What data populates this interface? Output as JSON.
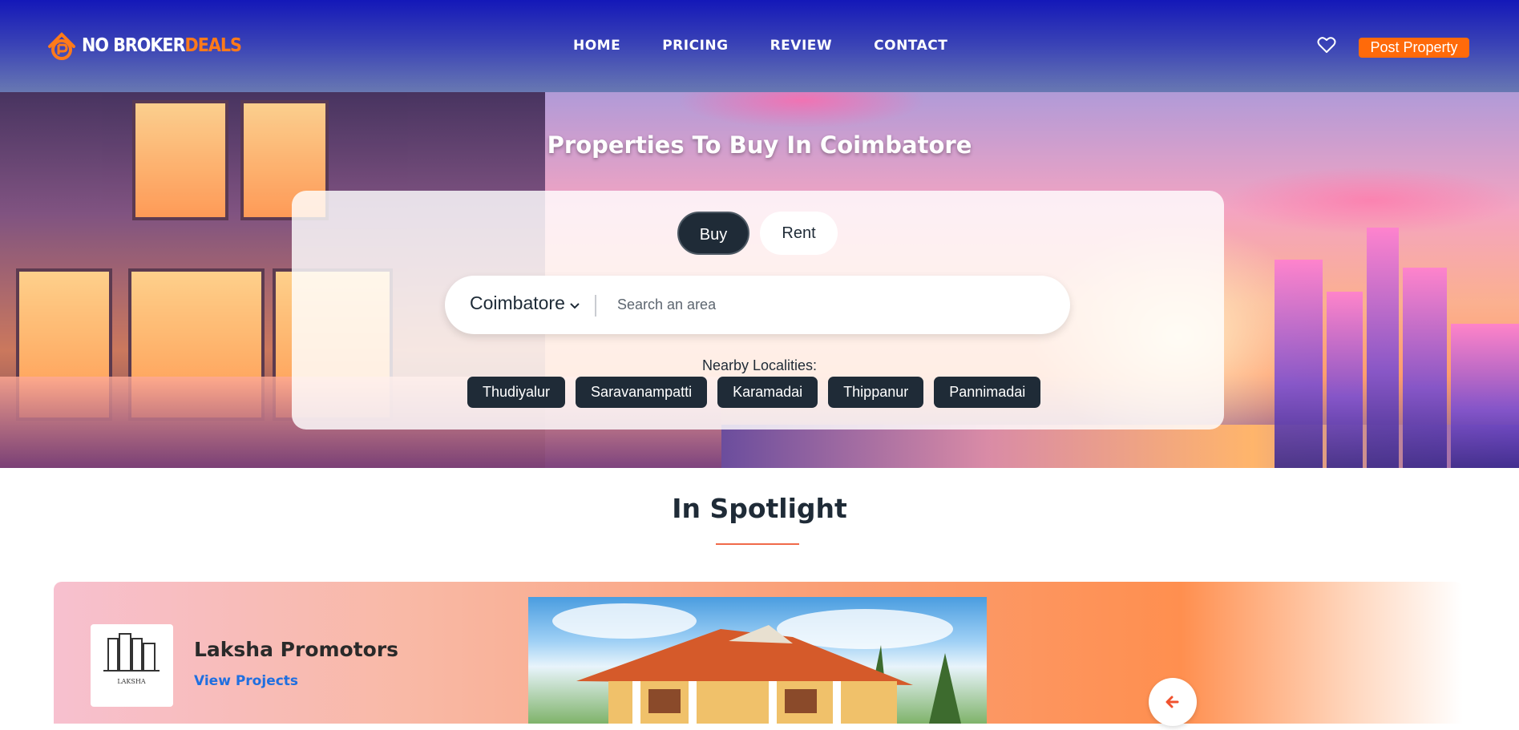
{
  "nav": {
    "logo": {
      "part1": "NO BROKER",
      "part2": "DEALS"
    },
    "menu": [
      "HOME",
      "PRICING",
      "REVIEW",
      "CONTACT"
    ],
    "post_property_label": "Post Property"
  },
  "hero": {
    "title": "Properties To Buy In Coimbatore",
    "tabs": {
      "buy": "Buy",
      "rent": "Rent"
    },
    "city_select": "Coimbatore",
    "search_placeholder": "Search an area",
    "nearby_label": "Nearby Localities:",
    "localities": [
      "Thudiyalur",
      "Saravanampatti",
      "Karamadai",
      "Thippanur",
      "Pannimadai"
    ]
  },
  "spotlight": {
    "title": "In Spotlight",
    "builder_name": "Laksha Promotors",
    "view_projects_label": "View Projects",
    "logo_text": "LAKSHA"
  },
  "colors": {
    "accent": "#ff6a0a",
    "dark": "#1f2b37",
    "link": "#1f6fe0"
  },
  "icons": [
    "home-logo-icon",
    "heart-icon",
    "chevron-down-icon",
    "arrow-left-icon"
  ]
}
